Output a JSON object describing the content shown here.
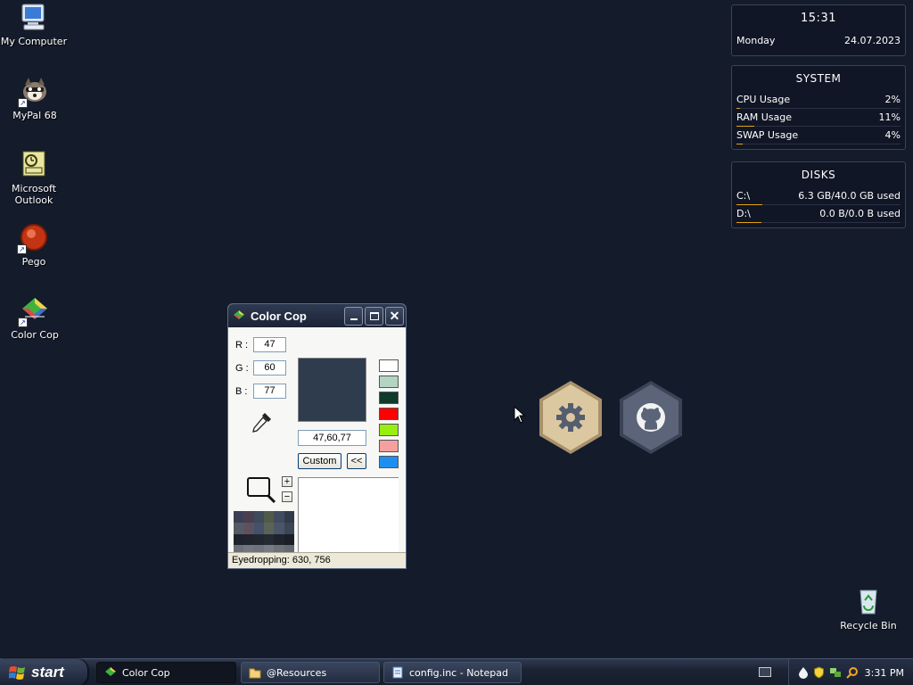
{
  "desktop": {
    "icons": [
      {
        "label": "My Computer"
      },
      {
        "label": "MyPal 68"
      },
      {
        "label": "Microsoft Outlook"
      },
      {
        "label": "Pego"
      },
      {
        "label": "Color Cop"
      },
      {
        "label": "Recycle Bin"
      }
    ]
  },
  "clock_widget": {
    "time": "15:31",
    "day": "Monday",
    "date": "24.07.2023"
  },
  "system_widget": {
    "title": "SYSTEM",
    "rows": [
      {
        "label": "CPU Usage",
        "value": "2%",
        "percent": 2
      },
      {
        "label": "RAM Usage",
        "value": "11%",
        "percent": 11
      },
      {
        "label": "SWAP Usage",
        "value": "4%",
        "percent": 4
      }
    ]
  },
  "disks_widget": {
    "title": "DISKS",
    "rows": [
      {
        "label": "C:\\",
        "value": "6.3 GB/40.0 GB used",
        "percent": 16
      },
      {
        "label": "D:\\",
        "value": "0.0 B/0.0 B used",
        "percent": 0
      }
    ]
  },
  "colorcop": {
    "title": "Color Cop",
    "r_label": "R :",
    "g_label": "G :",
    "b_label": "B :",
    "r": "47",
    "g": "60",
    "b": "77",
    "color_hex": "#2f3c4d",
    "value_text": "47,60,77",
    "custom_label": "Custom",
    "expand_label": "<<",
    "plus_label": "+",
    "minus_label": "−",
    "custom_colors": [
      "#ffffff",
      "#b3d4c0",
      "#0f3a2c",
      "#ff0000",
      "#99ee11",
      "#f4a0a0",
      "#1e8ff0"
    ],
    "status": "Eyedropping: 630, 756"
  },
  "taskbar": {
    "start_label": "start",
    "tasks": [
      {
        "label": "Color Cop",
        "active": true
      },
      {
        "label": "@Resources",
        "active": false
      },
      {
        "label": "config.inc - Notepad",
        "active": false
      }
    ],
    "clock": "3:31 PM"
  }
}
